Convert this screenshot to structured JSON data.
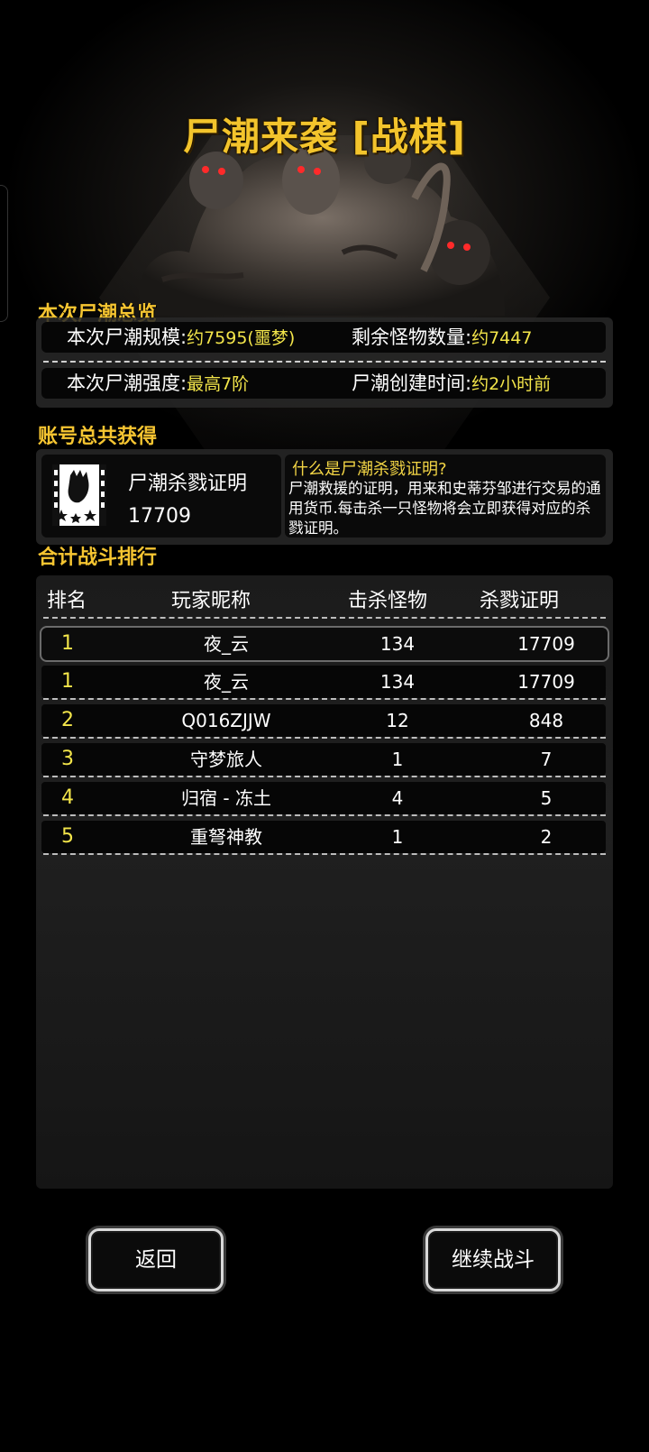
{
  "header": {
    "title": "尸潮来袭 [战棋]"
  },
  "overview": {
    "section_title": "本次尸潮总览",
    "scale_label": "本次尸潮规模:",
    "scale_value": "约7595(噩梦)",
    "remaining_label": "剩余怪物数量:",
    "remaining_value": "约7447",
    "strength_label": "本次尸潮强度:",
    "strength_value": "最高7阶",
    "created_label": "尸潮创建时间:",
    "created_value": "约2小时前"
  },
  "account": {
    "section_title": "账号总共获得",
    "reward_name": "尸潮杀戮证明",
    "reward_count": "17709",
    "info_question": "什么是尸潮杀戮证明?",
    "info_text": "尸潮救援的证明，用来和史蒂芬邹进行交易的通用货币.每击杀一只怪物将会立即获得对应的杀戮证明。"
  },
  "ranking": {
    "section_title": "合计战斗排行",
    "headers": {
      "rank": "排名",
      "name": "玩家昵称",
      "kills": "击杀怪物",
      "proof": "杀戮证明"
    },
    "my_row": {
      "rank": "1",
      "name": "夜_云",
      "kills": "134",
      "proof": "17709"
    },
    "rows": [
      {
        "rank": "1",
        "name": "夜_云",
        "kills": "134",
        "proof": "17709"
      },
      {
        "rank": "2",
        "name": "Q016ZJJW",
        "kills": "12",
        "proof": "848"
      },
      {
        "rank": "3",
        "name": "守梦旅人",
        "kills": "1",
        "proof": "7"
      },
      {
        "rank": "4",
        "name": "归宿 - 冻土",
        "kills": "4",
        "proof": "5"
      },
      {
        "rank": "5",
        "name": "重弩神教",
        "kills": "1",
        "proof": "2"
      }
    ]
  },
  "buttons": {
    "back": "返回",
    "continue": "继续战斗"
  },
  "colors": {
    "gold": "#f3c42c",
    "value_yellow": "#f3e54a",
    "background": "#000000"
  },
  "icons": {
    "cert": "kill-proof-certificate-icon"
  }
}
